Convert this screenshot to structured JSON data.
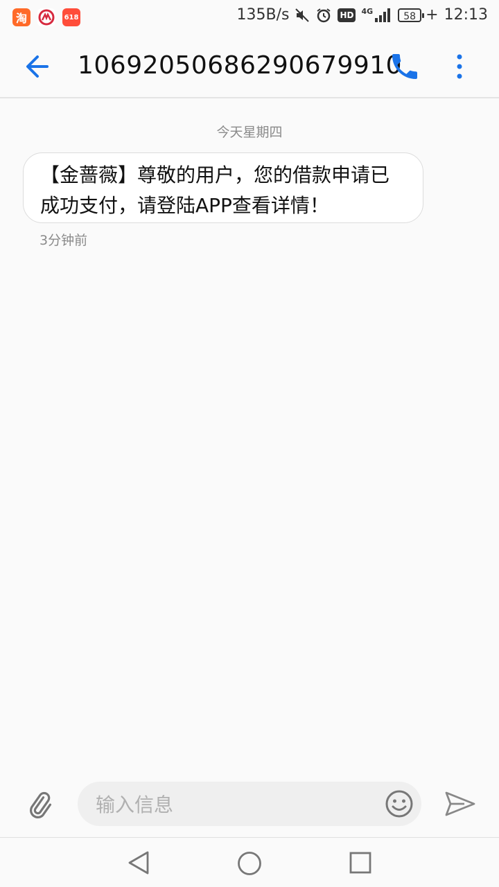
{
  "status_bar": {
    "apps": [
      {
        "name": "taobao-icon",
        "glyph": "淘",
        "color": "#ff5a1f"
      },
      {
        "name": "bank-icon",
        "glyph": "",
        "color": "#d6293e"
      },
      {
        "name": "shopping-618-icon",
        "glyph": "618",
        "color": "#ff4d3a"
      }
    ],
    "net_speed": "135B/s",
    "network": "4G",
    "hd_label": "HD",
    "battery": "58",
    "time": "12:13"
  },
  "appbar": {
    "title": "10692050686290679910"
  },
  "conversation": {
    "date_divider": "今天星期四",
    "messages": [
      {
        "text": "【金蔷薇】尊敬的用户，您的借款申请已成功支付，请登陆APP查看详情！",
        "time": "3分钟前"
      }
    ]
  },
  "compose": {
    "placeholder": "输入信息",
    "value": ""
  },
  "colors": {
    "accent": "#1a73e8",
    "background": "#fafafa",
    "bubble": "#ffffff"
  }
}
